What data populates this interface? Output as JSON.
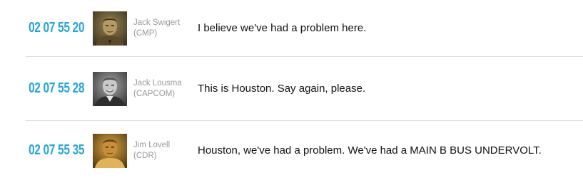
{
  "entries": [
    {
      "time": "02 07 55 20",
      "speaker": "Jack Swigert",
      "role": "(CMP)",
      "text": "I believe we've had a problem here.",
      "portrait": "swigert-portrait"
    },
    {
      "time": "02 07 55 28",
      "speaker": "Jack Lousma",
      "role": "(CAPCOM)",
      "text": "This is Houston. Say again, please.",
      "portrait": "lousma-portrait"
    },
    {
      "time": "02 07 55 35",
      "speaker": "Jim Lovell",
      "role": "(CDR)",
      "text": "Houston, we've had a problem. We've had a MAIN B BUS UNDERVOLT.",
      "portrait": "lovell-portrait"
    }
  ],
  "colors": {
    "timestamp": "#27a6d6",
    "speaker": "#9a9a9a",
    "text": "#111111",
    "divider": "#dcdcdc"
  }
}
